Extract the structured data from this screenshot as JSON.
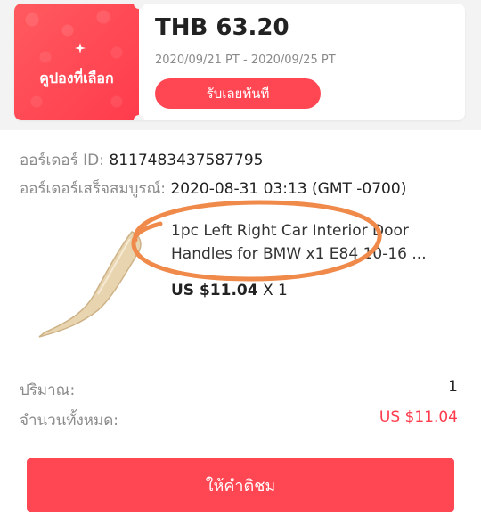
{
  "coupon": {
    "left_label": "คูปองที่เลือก",
    "amount": "THB 63.20",
    "validity": "2020/09/21 PT - 2020/09/25 PT",
    "claim_label": "รับเลยทันที"
  },
  "order": {
    "id_label": "ออร์เดอร์ ID:",
    "id_value": "8117483437587795",
    "complete_label": "ออร์เดอร์เสร็จสมบูรณ์:",
    "complete_value": "2020-08-31 03:13 (GMT -0700)"
  },
  "product": {
    "title": "1pc Left Right Car Interior Door Handles for BMW x1 E84 10-16 ...",
    "price": "US $11.04",
    "qty_text": "X 1"
  },
  "summary": {
    "quantity_label": "ปริมาณ:",
    "quantity_value": "1",
    "total_label": "จำนวนทั้งหมด:",
    "total_value": "US $11.04"
  },
  "actions": {
    "review_label": "ให้คำติชม"
  },
  "colors": {
    "accent": "#ff4653",
    "annotation": "#f08a4b"
  },
  "icons": {
    "sparkle": "sparkle-icon"
  }
}
